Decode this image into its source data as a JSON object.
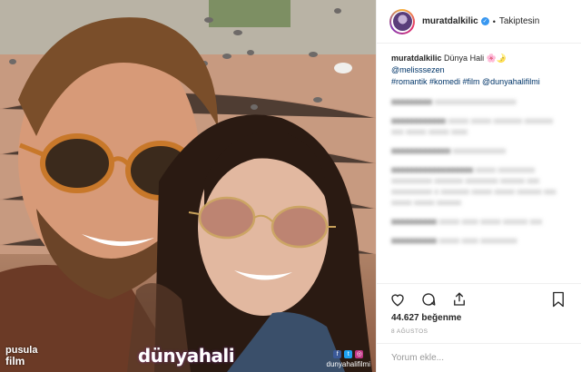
{
  "post": {
    "username": "muratdalkilic",
    "follow_status": "Takiptesin",
    "caption": {
      "username": "muratdalkilic",
      "text": "Dünya Hali 🌸🌛",
      "mention": "@melisssezen",
      "tags": "#romantik #komedi #film @dunyahalifilmi"
    },
    "blurred_comments": [
      {
        "user": "xxxxxxxxx",
        "text": "xxxxxxxxxxxxxxxxxxxx"
      },
      {
        "user": "xxxxxxxxxxxx",
        "text": "xxxxx xxxxx xxxxxxx xxxxxxx xxx xxxxx xxxxx xxxx"
      },
      {
        "user": "xxxxxxxxxxxxx",
        "text": "xxxxxxxxxxxxx"
      },
      {
        "user": "xxxxxxxxxxxxxxxxxx",
        "text": "xxxxx xxxxxxxxx xxxxxxxxxx xxxxxxx xxxxxxxx xxxxxx xxx xxxxxxxxxx x xxxxxxx xxxxx xxxxx xxxxxx xxx xxxxx xxxxx xxxxxx"
      },
      {
        "user": "xxxxxxxxxx",
        "text": "xxxxx xxxx xxxxx xxxxxx xxx"
      },
      {
        "user": "xxxxxxxxxx",
        "text": "xxxxx xxxx xxxxxxxxx"
      }
    ],
    "likes": "44.627 beğenme",
    "date": "8 AĞUSTOS",
    "comment_placeholder": "Yorum ekle..."
  },
  "photo": {
    "watermark_left_line1": "pusula",
    "watermark_left_line2": "film",
    "watermark_center_brand_pre": "dünya",
    "watermark_center_brand_post": "hali",
    "watermark_right_handle": "dunyahalifilmi"
  },
  "icons": {
    "heart": "heart-icon",
    "comment": "comment-icon",
    "share": "share-icon",
    "bookmark": "bookmark-icon"
  },
  "colors": {
    "verified_blue": "#3897f0",
    "link_blue": "#003569",
    "muted": "#999999"
  }
}
